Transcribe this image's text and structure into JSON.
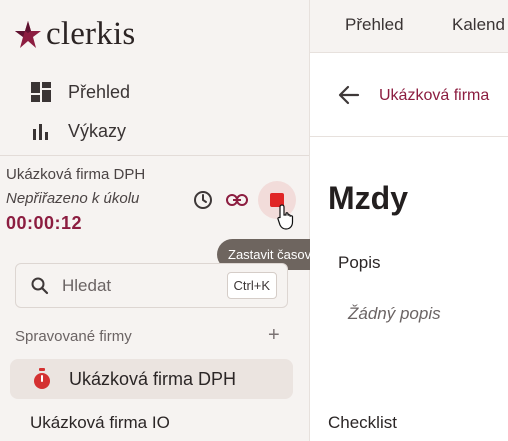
{
  "app": {
    "logo_text": "clerkis"
  },
  "sidebar": {
    "nav": [
      {
        "label": "Přehled",
        "icon": "dashboard-icon"
      },
      {
        "label": "Výkazy",
        "icon": "bar-chart-icon"
      }
    ],
    "timer": {
      "firm": "Ukázková firma DPH",
      "task": "Nepřiřazeno k úkolu",
      "time": "00:00:12",
      "stop_tooltip": "Zastavit časovač"
    },
    "search": {
      "placeholder": "Hledat",
      "shortcut": "Ctrl+K"
    },
    "section_title": "Spravované firmy",
    "firms": [
      {
        "label": "Ukázková firma DPH",
        "active": true
      },
      {
        "label": "Ukázková firma IO",
        "active": false
      }
    ]
  },
  "main": {
    "tabs": [
      "Přehled",
      "Kalend"
    ],
    "breadcrumb": "Ukázková firma",
    "title": "Mzdy",
    "description_label": "Popis",
    "description_empty": "Žádný popis",
    "checklist_label": "Checklist"
  },
  "colors": {
    "accent": "#8c1d40",
    "stop": "#e02525",
    "tooltip_bg": "#6e655f"
  }
}
